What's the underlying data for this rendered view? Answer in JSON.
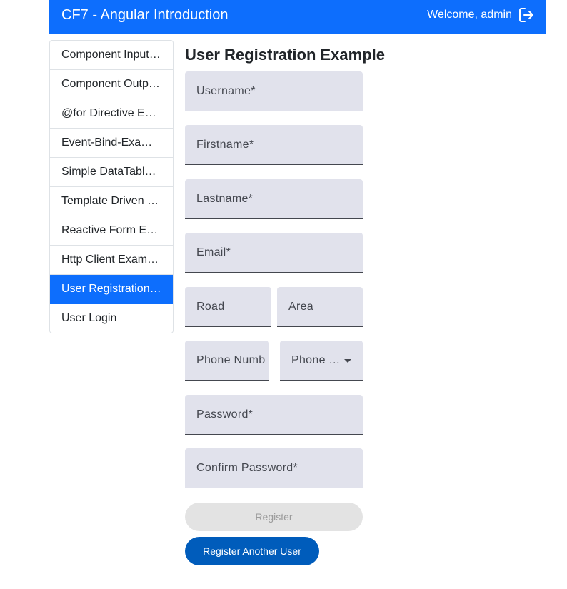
{
  "header": {
    "title": "CF7 - Angular Introduction",
    "welcome": "Welcome, admin"
  },
  "sidebar": {
    "items": [
      {
        "label": "Component Input Example",
        "active": false
      },
      {
        "label": "Component Output Example",
        "active": false
      },
      {
        "label": "@for Directive Example",
        "active": false
      },
      {
        "label": "Event-Bind-Example",
        "active": false
      },
      {
        "label": "Simple DataTable Example",
        "active": false
      },
      {
        "label": "Template Driven Form Example",
        "active": false
      },
      {
        "label": "Reactive Form Example",
        "active": false
      },
      {
        "label": "Http Client Example",
        "active": false
      },
      {
        "label": "User Registration Example",
        "active": true
      },
      {
        "label": "User Login",
        "active": false
      }
    ]
  },
  "form": {
    "title": "User Registration Example",
    "fields": {
      "username": "Username*",
      "firstname": "Firstname*",
      "lastname": "Lastname*",
      "email": "Email*",
      "road": "Road",
      "area": "Area",
      "phone_number": "Phone Number",
      "phone_type": "Phone Type",
      "password": "Password*",
      "confirm_password": "Confirm Password*"
    },
    "register_button": "Register",
    "register_another_button": "Register Another User"
  },
  "colors": {
    "primary": "#0d6efd",
    "button_primary": "#005cbb",
    "field_background": "#e1e2ec"
  },
  "icons": {
    "logout": "logout-icon",
    "select_caret": "caret-down-icon"
  }
}
